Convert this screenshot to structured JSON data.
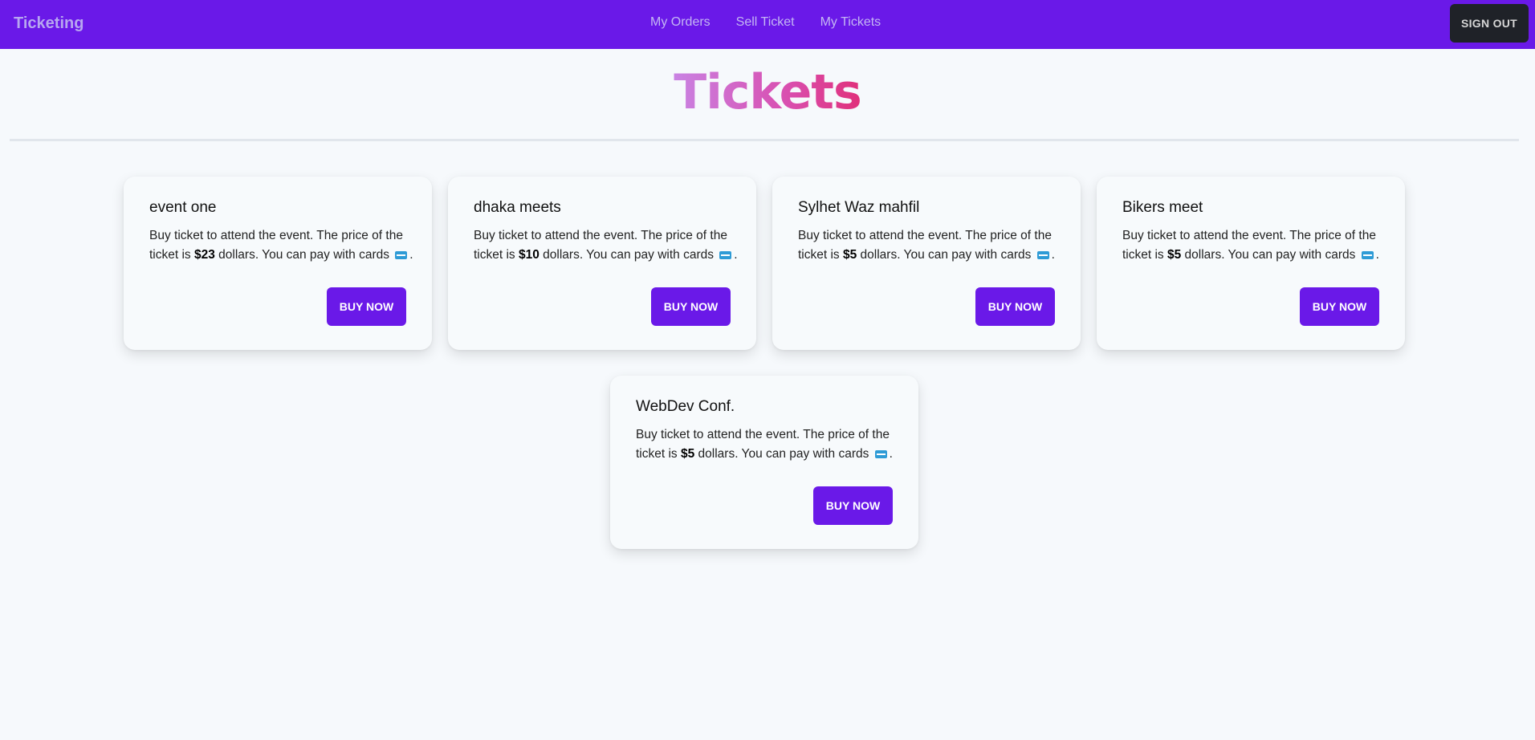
{
  "navbar": {
    "brand": "Ticketing",
    "links": [
      "My Orders",
      "Sell Ticket",
      "My Tickets"
    ],
    "signout_label": "SIGN OUT"
  },
  "page_title": "Tickets",
  "cards": [
    {
      "title": "event one",
      "text_before": "Buy ticket to attend the event. The price of the ticket is ",
      "price": "$23",
      "text_after": " dollars. You can pay with cards ",
      "text_end": ".",
      "button": "BUY NOW"
    },
    {
      "title": "dhaka meets",
      "text_before": "Buy ticket to attend the event. The price of the ticket is ",
      "price": "$10",
      "text_after": " dollars. You can pay with cards ",
      "text_end": ".",
      "button": "BUY NOW"
    },
    {
      "title": "Sylhet Waz mahfil",
      "text_before": "Buy ticket to attend the event. The price of the ticket is ",
      "price": "$5",
      "text_after": " dollars. You can pay with cards ",
      "text_end": ".",
      "button": "BUY NOW"
    },
    {
      "title": "Bikers meet",
      "text_before": "Buy ticket to attend the event. The price of the ticket is ",
      "price": "$5",
      "text_after": " dollars. You can pay with cards ",
      "text_end": ".",
      "button": "BUY NOW"
    },
    {
      "title": "WebDev Conf.",
      "text_before": "Buy ticket to attend the event. The price of the ticket is ",
      "price": "$5",
      "text_after": " dollars. You can pay with cards ",
      "text_end": ".",
      "button": "BUY NOW"
    }
  ],
  "icons": {
    "card_payment": "credit-card-icon"
  },
  "colors": {
    "primary": "#6a19e8",
    "signout_bg": "#1f2228",
    "background": "#f6f9fc"
  }
}
